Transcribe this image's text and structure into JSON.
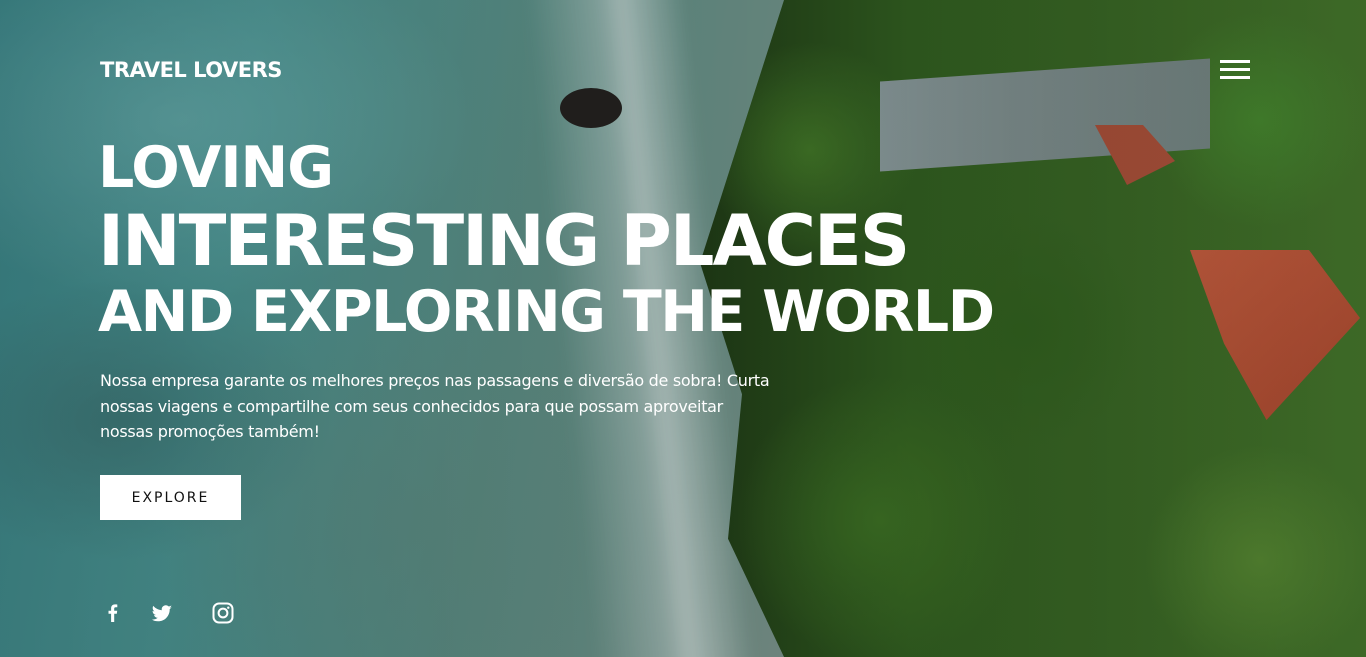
{
  "header": {
    "brand": "TRAVEL LOVERS",
    "menu_icon": "hamburger-menu-icon"
  },
  "hero": {
    "headline": {
      "line1": "LOVING",
      "line2": "INTERESTING PLACES",
      "line3": "AND EXPLORING THE WORLD"
    },
    "description": "Nossa empresa garante os melhores preços nas passagens e diversão de sobra! Curta nossas viagens e compartilhe com seus conhecidos para que possam aproveitar nossas promoções também!",
    "cta_label": "EXPLORE"
  },
  "social": {
    "icons": [
      "facebook-icon",
      "twitter-icon",
      "instagram-icon"
    ]
  },
  "colors": {
    "text": "#ffffff",
    "button_bg": "#ffffff",
    "button_text": "#111111"
  }
}
